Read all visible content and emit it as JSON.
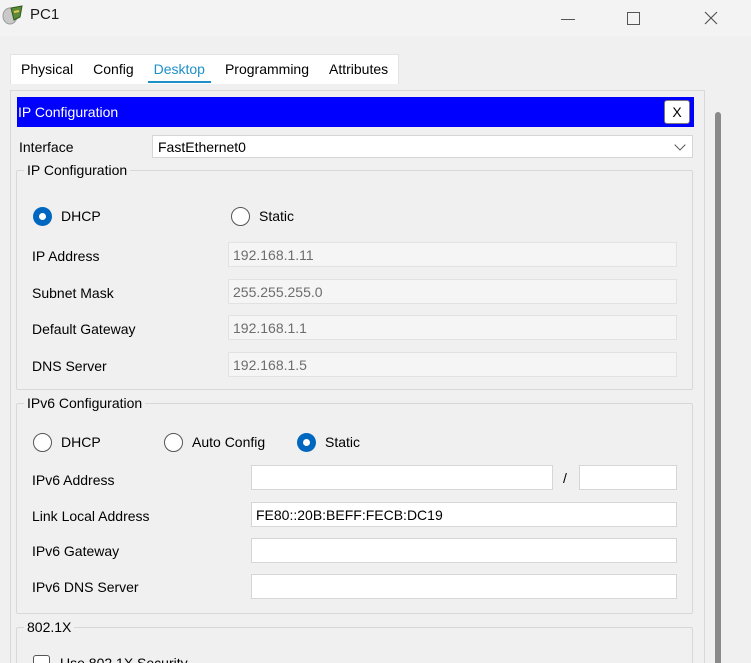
{
  "window": {
    "title": "PC1",
    "icons": {
      "app": "packet-tracer-pc-icon",
      "minimize": "minimize-icon",
      "maximize": "maximize-icon",
      "close": "close-icon"
    }
  },
  "tabs": [
    {
      "label": "Physical",
      "active": false
    },
    {
      "label": "Config",
      "active": false
    },
    {
      "label": "Desktop",
      "active": true
    },
    {
      "label": "Programming",
      "active": false
    },
    {
      "label": "Attributes",
      "active": false
    }
  ],
  "header": {
    "title": "IP Configuration",
    "close_label": "X",
    "background": "#0000ff"
  },
  "interface": {
    "label": "Interface",
    "value": "FastEthernet0"
  },
  "ipv4": {
    "legend": "IP Configuration",
    "dhcp_label": "DHCP",
    "static_label": "Static",
    "mode": "DHCP",
    "ip_address_label": "IP Address",
    "ip_address": "192.168.1.11",
    "subnet_mask_label": "Subnet Mask",
    "subnet_mask": "255.255.255.0",
    "gateway_label": "Default Gateway",
    "gateway": "192.168.1.1",
    "dns_label": "DNS Server",
    "dns": "192.168.1.5"
  },
  "ipv6": {
    "legend": "IPv6 Configuration",
    "dhcp_label": "DHCP",
    "auto_label": "Auto Config",
    "static_label": "Static",
    "mode": "Static",
    "address_label": "IPv6 Address",
    "address": "",
    "prefix_separator": "/",
    "prefix": "",
    "link_local_label": "Link Local Address",
    "link_local": "FE80::20B:BEFF:FECB:DC19",
    "gateway_label": "IPv6 Gateway",
    "gateway": "",
    "dns_label": "IPv6 DNS Server",
    "dns": ""
  },
  "dot1x": {
    "legend": "802.1X",
    "use_label": "Use 802.1X Security",
    "enabled": false
  },
  "colors": {
    "accent": "#1e90c8",
    "radio_selected": "#0067c0",
    "panel_bg": "#f0f0f0"
  }
}
